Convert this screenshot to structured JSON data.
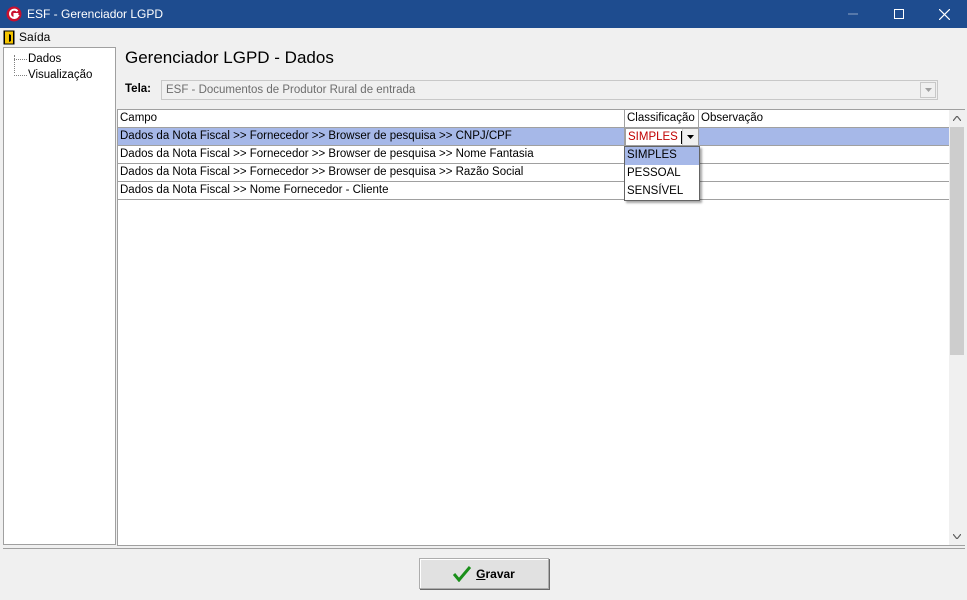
{
  "window": {
    "title": "ESF - Gerenciador LGPD"
  },
  "menu": {
    "saida_label": "Saída"
  },
  "tree": {
    "items": [
      {
        "label": "Dados"
      },
      {
        "label": "Visualização"
      }
    ]
  },
  "page": {
    "title": "Gerenciador LGPD - Dados",
    "tela_label": "Tela:",
    "tela_value": "ESF - Documentos de Produtor Rural de entrada"
  },
  "grid": {
    "columns": [
      "Campo",
      "Classificação",
      "Observação"
    ],
    "rows": [
      {
        "campo": "Dados da Nota Fiscal  >>  Fornecedor >> Browser de pesquisa >> CNPJ/CPF",
        "classificacao": "SIMPLES",
        "observacao": ""
      },
      {
        "campo": "Dados da Nota Fiscal  >>  Fornecedor >> Browser de pesquisa >> Nome Fantasia",
        "classificacao": "",
        "observacao": ""
      },
      {
        "campo": "Dados da Nota Fiscal  >>  Fornecedor >> Browser de pesquisa >> Razão Social",
        "classificacao": "",
        "observacao": ""
      },
      {
        "campo": "Dados da Nota Fiscal  >> Nome Fornecedor - Cliente",
        "classificacao": "",
        "observacao": ""
      }
    ],
    "editor_value": "SIMPLES",
    "dropdown_options": [
      "SIMPLES",
      "PESSOAL",
      "SENSÍVEL"
    ]
  },
  "footer": {
    "gravar_label_underlined": "G",
    "gravar_label_rest": "ravar"
  },
  "colors": {
    "titlebar": "#1e4c8f",
    "selection": "#a6b8e8",
    "editor_text": "#c00000",
    "check": "#1a8f1a"
  }
}
